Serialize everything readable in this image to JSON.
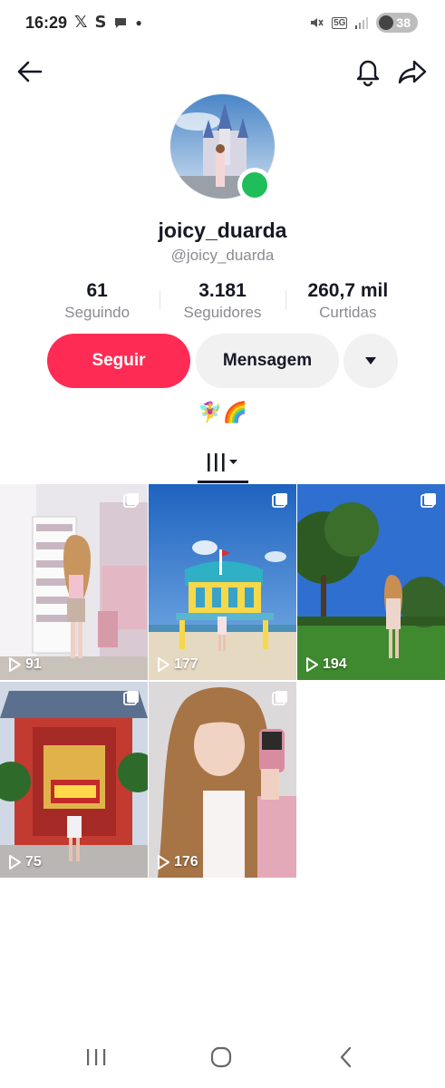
{
  "status_bar": {
    "time": "16:29",
    "left_icons": [
      "x-icon",
      "s-icon",
      "chat-bubble-icon",
      "dot-icon"
    ],
    "network": "5G",
    "battery": "38"
  },
  "nav": {
    "back_icon": "arrow-left-icon",
    "bell_icon": "bell-icon",
    "share_icon": "share-arrow-icon"
  },
  "profile": {
    "display_name": "joicy_duarda",
    "handle": "@joicy_duarda",
    "online_color": "#1fbe5a"
  },
  "stats": [
    {
      "value": "61",
      "label": "Seguindo"
    },
    {
      "value": "3.181",
      "label": "Seguidores"
    },
    {
      "value": "260,7 mil",
      "label": "Curtidas"
    }
  ],
  "actions": {
    "follow_label": "Seguir",
    "message_label": "Mensagem",
    "follow_color": "#fe2c55"
  },
  "bio": "🧚‍♀️🌈",
  "videos": [
    {
      "views": "91"
    },
    {
      "views": "177"
    },
    {
      "views": "194"
    },
    {
      "views": "75"
    },
    {
      "views": "176"
    }
  ]
}
